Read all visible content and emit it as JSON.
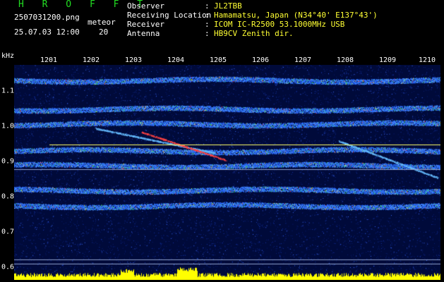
{
  "header": {
    "logo": "H R O F F T",
    "filename": "2507031200.png",
    "meteor_label": "meteor",
    "datetime": "25.07.03 12:00",
    "meteor_count": "20",
    "fields": [
      {
        "label": "Observer",
        "value": "JL2TBB"
      },
      {
        "label": "Receiving Location",
        "value": "Hamamatsu, Japan (N34°40' E137°43')"
      },
      {
        "label": "Receiver",
        "value": "ICOM IC-R2500 53.1000MHz USB"
      },
      {
        "label": "Antenna",
        "value": "HB9CV Zenith dir."
      }
    ],
    "separator": ":"
  },
  "axes": {
    "y_unit": "kHz",
    "x_ticks": [
      "1201",
      "1202",
      "1203",
      "1204",
      "1205",
      "1206",
      "1207",
      "1208",
      "1209",
      "1210"
    ],
    "y_ticks": [
      "1.1",
      "1.0",
      "0.9",
      "0.8",
      "0.7",
      "0.6"
    ]
  },
  "colors": {
    "header_text": "#ffffff",
    "value_text": "#ffff33",
    "logo": "#22dd22",
    "background": "#000000",
    "spectrum_base": "#000a50",
    "signal_band": "#2a6cff",
    "echo_hot": "#ff3030",
    "marker_line": "#ffff66",
    "meteor_trace": "#ffff00"
  }
}
